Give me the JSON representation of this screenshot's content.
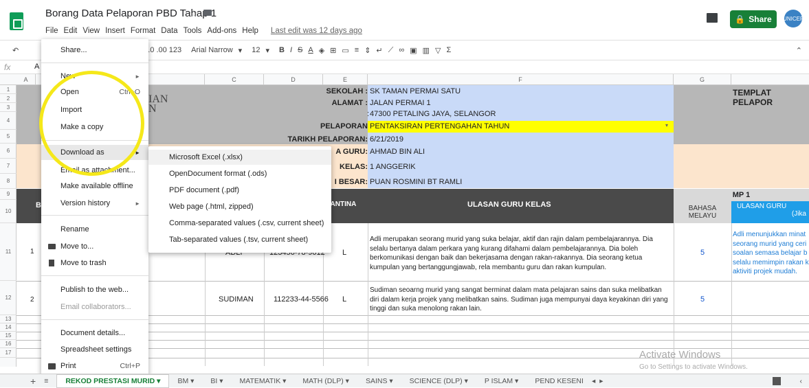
{
  "window": {
    "title": "Borang Data Pelaporan PBD Tahap 1",
    "last_edit": "Last edit was 12 days ago",
    "share_label": "Share",
    "avatar_text": "UNICEF"
  },
  "menubar": [
    "File",
    "Edit",
    "View",
    "Insert",
    "Format",
    "Data",
    "Tools",
    "Add-ons",
    "Help"
  ],
  "toolbar": {
    "zoom": ".0  .00  123",
    "font": "Arial Narrow",
    "size": "12"
  },
  "formula": {
    "fx": "fx",
    "ref": "A"
  },
  "columns": [
    "A",
    "B",
    "C",
    "D",
    "E",
    "F",
    "G"
  ],
  "rows": [
    "1",
    "2",
    "3",
    "4",
    "5",
    "6",
    "7",
    "8",
    "9",
    "10",
    "11",
    "12",
    "13",
    "14",
    "15",
    "16",
    "17"
  ],
  "header_info": {
    "sekolah_lbl": "SEKOLAH :",
    "sekolah": "SK TAMAN PERMAI SATU",
    "alamat_lbl": "ALAMAT :",
    "alamat1": "JALAN PERMAI 1",
    "alamat_colon": ":",
    "alamat2": "47300 PETALING JAYA, SELANGOR",
    "pelaporan_lbl": "PELAPORAN",
    "pelaporan": "PENTAKSIRAN PERTENGAHAN TAHUN",
    "tarikh_lbl": "TARIKH PELAPORAN:",
    "tarikh": "6/21/2019",
    "guru_lbl": "A GURU:",
    "guru": "AHMAD BIN ALI",
    "kelas_lbl": "KELAS:",
    "kelas": "1 ANGGERIK",
    "besar_lbl": "I BESAR:",
    "besar": "PUAN ROSMINI BT RAMLI",
    "templat": "TEMPLAT PELAPOR",
    "partial_ian": "IAN",
    "partial_n": "N",
    "col_b": "B",
    "jantina": "JANTINA",
    "ulasan": "ULASAN GURU KELAS",
    "mp1": "MP 1",
    "bahasa": "BAHASA",
    "melayu": "MELAYU",
    "ulasan_guru": "ULASAN GURU",
    "jika": "(Jika"
  },
  "students": [
    {
      "row": "1",
      "name": "ADLI",
      "ic": "123456-78-9012",
      "gender": "L",
      "bm": "5",
      "comment": "Adli merupakan seorang murid yang suka belajar, aktif dan rajin dalam pembelajarannya. Dia selalu bertanya dalam perkara yang kurang difahami dalam pembelajarannya. Dia boleh berkomunikasi dengan baik dan bekerjasama dengan rakan-rakannya. Dia seorang ketua kumpulan yang bertanggungjawab, rela membantu guru dan rakan kumpulan.",
      "mp_comment": "Adli menunjukkan minat seorang murid yang ceri soalan semasa belajar b selalu memimpin rakan k aktiviti projek mudah."
    },
    {
      "row": "2",
      "name": "SUDIMAN",
      "ic": "112233-44-5566",
      "gender": "L",
      "bm": "5",
      "comment": "Sudiman seoarng murid yang sangat berminat dalam mata pelajaran sains dan suka melibatkan diri dalam kerja projek yang melibatkan sains. Sudiman juga mempunyai daya keyakinan diri yang tinggi dan suka menolong rakan lain.",
      "mp_comment": ""
    }
  ],
  "file_menu": {
    "share": "Share...",
    "new": "New",
    "open": "Open",
    "open_sc": "Ctrl+O",
    "import": "Import",
    "copy": "Make a copy",
    "download": "Download as",
    "email": "Email as attachment...",
    "offline": "Make available offline",
    "version": "Version history",
    "rename": "Rename",
    "move": "Move to...",
    "trash": "Move to trash",
    "publish": "Publish to the web...",
    "collab": "Email collaborators...",
    "details": "Document details...",
    "settings": "Spreadsheet settings",
    "print": "Print",
    "print_sc": "Ctrl+P"
  },
  "download_menu": [
    "Microsoft Excel (.xlsx)",
    "OpenDocument format (.ods)",
    "PDF document (.pdf)",
    "Web page (.html, zipped)",
    "Comma-separated values (.csv, current sheet)",
    "Tab-separated values (.tsv, current sheet)"
  ],
  "sheet_tabs": [
    "REKOD PRESTASI MURID",
    "BM",
    "BI",
    "MATEMATIK",
    "MATH (DLP)",
    "SAINS",
    "SCIENCE (DLP)",
    "P ISLAM",
    "PEND KESENI"
  ],
  "watermark": {
    "title": "Activate Windows",
    "sub": "Go to Settings to activate Windows."
  },
  "colors": {
    "share": "#188038",
    "highlight": "#f5e81a",
    "dark_header": "#4a4a4a",
    "info_blue": "#c9daf8"
  }
}
